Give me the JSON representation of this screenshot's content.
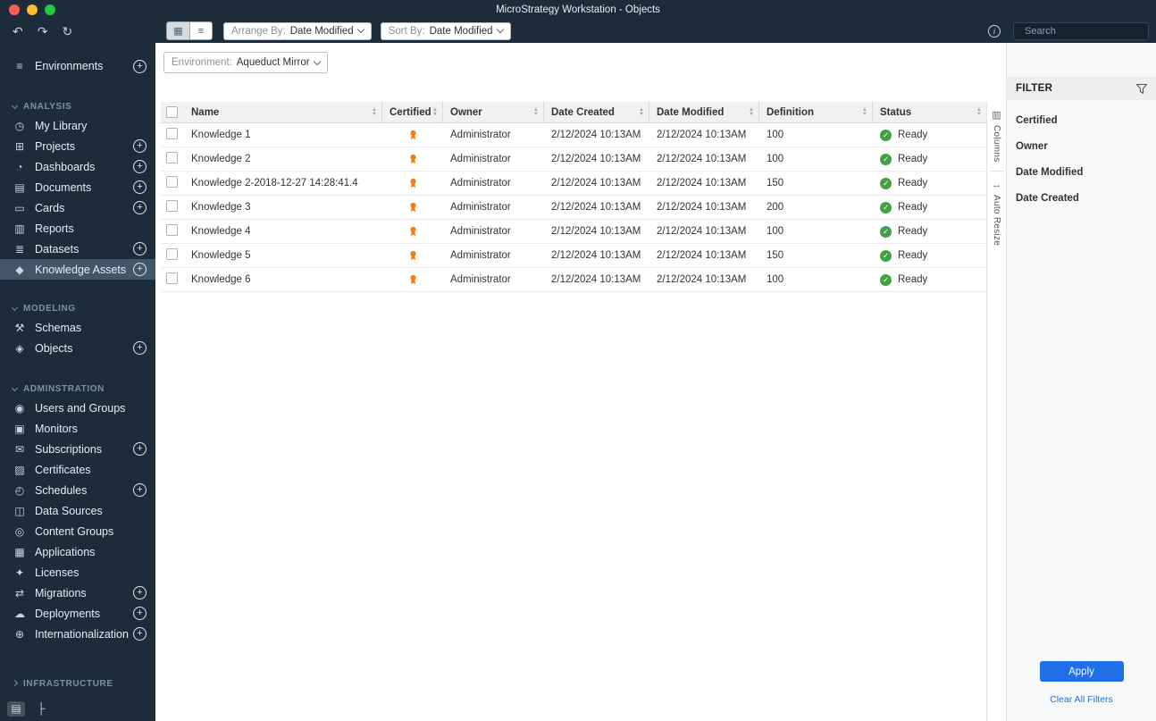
{
  "window": {
    "title": "MicroStrategy Workstation - Objects"
  },
  "toolbar": {
    "arrange_by_label": "Arrange By:",
    "arrange_by_value": "Date Modified",
    "sort_by_label": "Sort By:",
    "sort_by_value": "Date Modified",
    "search_placeholder": "Search"
  },
  "environment_bar": {
    "label": "Environment:",
    "value": "Aqueduct Mirror"
  },
  "sidebar": {
    "environments": {
      "label": "Environments"
    },
    "sections": [
      {
        "label": "ANALYSIS",
        "items": [
          {
            "label": "My Library"
          },
          {
            "label": "Projects"
          },
          {
            "label": "Dashboards"
          },
          {
            "label": "Documents"
          },
          {
            "label": "Cards"
          },
          {
            "label": "Reports"
          },
          {
            "label": "Datasets"
          },
          {
            "label": "Knowledge Assets"
          }
        ]
      },
      {
        "label": "MODELING",
        "items": [
          {
            "label": "Schemas"
          },
          {
            "label": "Objects"
          }
        ]
      },
      {
        "label": "ADMINSTRATION",
        "items": [
          {
            "label": "Users and Groups"
          },
          {
            "label": "Monitors"
          },
          {
            "label": "Subscriptions"
          },
          {
            "label": "Certificates"
          },
          {
            "label": "Schedules"
          },
          {
            "label": "Data Sources"
          },
          {
            "label": "Content Groups"
          },
          {
            "label": "Applications"
          },
          {
            "label": "Licenses"
          },
          {
            "label": "Migrations"
          },
          {
            "label": "Deployments"
          },
          {
            "label": "Internationalization"
          }
        ]
      },
      {
        "label": "INFRASTRUCTURE",
        "items": []
      }
    ]
  },
  "icons": {
    "environments": "≡",
    "my_library": "◷",
    "projects": "⊞",
    "dashboards": "◔",
    "documents": "▤",
    "cards": "▭",
    "reports": "▥",
    "datasets": "≣",
    "knowledge_assets": "◆",
    "schemas": "⚒",
    "objects": "◈",
    "users_and_groups": "◉",
    "monitors": "▣",
    "subscriptions": "✉",
    "certificates": "▨",
    "schedules": "◴",
    "data_sources": "◫",
    "content_groups": "◎",
    "applications": "▦",
    "licenses": "✦",
    "migrations": "⇄",
    "deployments": "☁",
    "internationalization": "⊕",
    "undo": "↶",
    "redo": "↷",
    "refresh": "↻",
    "grid_view": "▦",
    "list_view": "≡",
    "info": "i",
    "columns": "▥",
    "auto_resize": "↔",
    "list_panel": "▤",
    "tree_panel": "├"
  },
  "table": {
    "columns": [
      "Name",
      "Certified",
      "Owner",
      "Date Created",
      "Date Modified",
      "Definition",
      "Status"
    ],
    "rows": [
      {
        "name": "Knowledge 1",
        "owner": "Administrator",
        "date_created": "2/12/2024 10:13AM",
        "date_modified": "2/12/2024 10:13AM",
        "definition": "100",
        "status": "Ready"
      },
      {
        "name": "Knowledge 2",
        "owner": "Administrator",
        "date_created": "2/12/2024 10:13AM",
        "date_modified": "2/12/2024 10:13AM",
        "definition": "100",
        "status": "Ready"
      },
      {
        "name": "Knowledge 2-2018-12-27 14:28:41.4",
        "owner": "Administrator",
        "date_created": "2/12/2024 10:13AM",
        "date_modified": "2/12/2024 10:13AM",
        "definition": "150",
        "status": "Ready"
      },
      {
        "name": "Knowledge 3",
        "owner": "Administrator",
        "date_created": "2/12/2024 10:13AM",
        "date_modified": "2/12/2024 10:13AM",
        "definition": "200",
        "status": "Ready"
      },
      {
        "name": "Knowledge 4",
        "owner": "Administrator",
        "date_created": "2/12/2024 10:13AM",
        "date_modified": "2/12/2024 10:13AM",
        "definition": "100",
        "status": "Ready"
      },
      {
        "name": "Knowledge 5",
        "owner": "Administrator",
        "date_created": "2/12/2024 10:13AM",
        "date_modified": "2/12/2024 10:13AM",
        "definition": "150",
        "status": "Ready"
      },
      {
        "name": "Knowledge 6",
        "owner": "Administrator",
        "date_created": "2/12/2024 10:13AM",
        "date_modified": "2/12/2024 10:13AM",
        "definition": "100",
        "status": "Ready"
      }
    ]
  },
  "rail": {
    "columns_label": "Columns",
    "auto_resize_label": "Auto Resize"
  },
  "filter": {
    "title": "FILTER",
    "items": [
      "Certified",
      "Owner",
      "Date Modified",
      "Date Created"
    ],
    "apply_label": "Apply",
    "clear_label": "Clear All Filters"
  },
  "colors": {
    "accent_blue": "#1e6fe8",
    "certified_orange": "#ee7d18",
    "status_green": "#43a047",
    "chrome_navy": "#1d2c3b"
  }
}
